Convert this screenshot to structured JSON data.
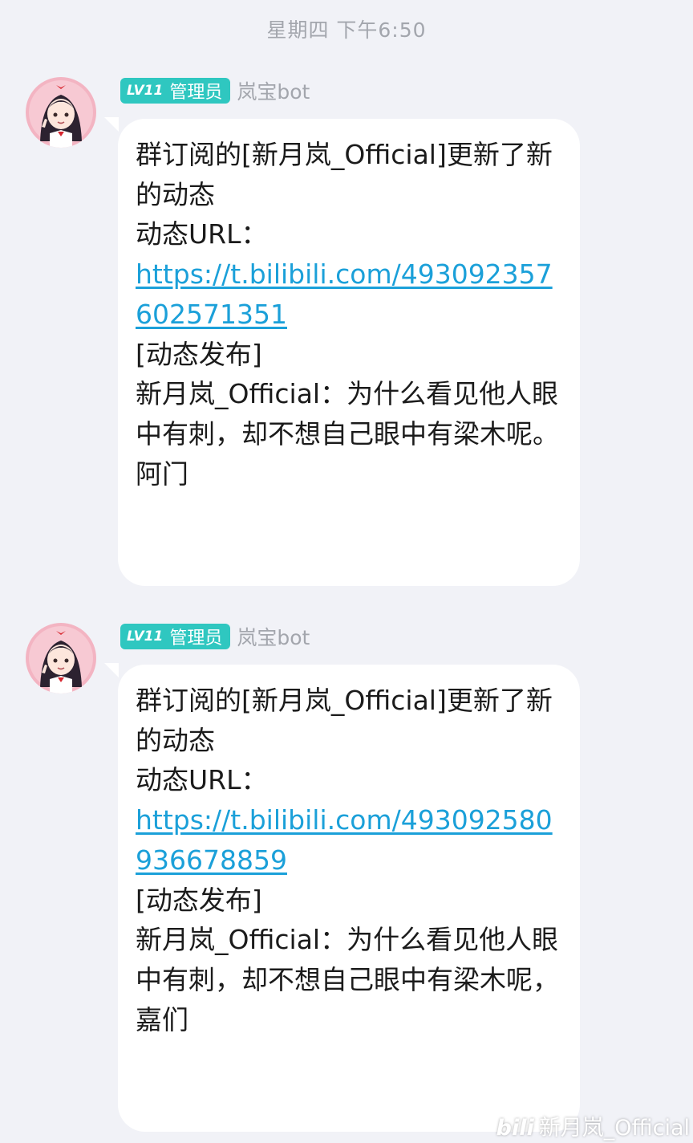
{
  "header": {
    "timestamp": "星期四 下午6:50"
  },
  "messages": [
    {
      "level": "LV11",
      "role": "管理员",
      "sender": "岚宝bot",
      "lines": [
        "群订阅的[新月岚_Official]更新了新的动态",
        "动态URL：",
        "https://t.bilibili.com/493092357602571351",
        "[动态发布]",
        "新月岚_Official：为什么看见他人眼中有刺，却不想自己眼中有梁木呢。阿门"
      ]
    },
    {
      "level": "LV11",
      "role": "管理员",
      "sender": "岚宝bot",
      "lines": [
        "群订阅的[新月岚_Official]更新了新的动态",
        "动态URL：",
        "https://t.bilibili.com/493092580936678859",
        "[动态发布]",
        "新月岚_Official：为什么看见他人眼中有刺，却不想自己眼中有梁木呢，嘉们"
      ]
    }
  ],
  "watermark": {
    "logo": "bili",
    "text": "新月岚_Official"
  },
  "colors": {
    "background": "#f1f2f7",
    "bubble": "#ffffff",
    "badge": "#2fc7c0",
    "link": "#1ba0d9"
  }
}
